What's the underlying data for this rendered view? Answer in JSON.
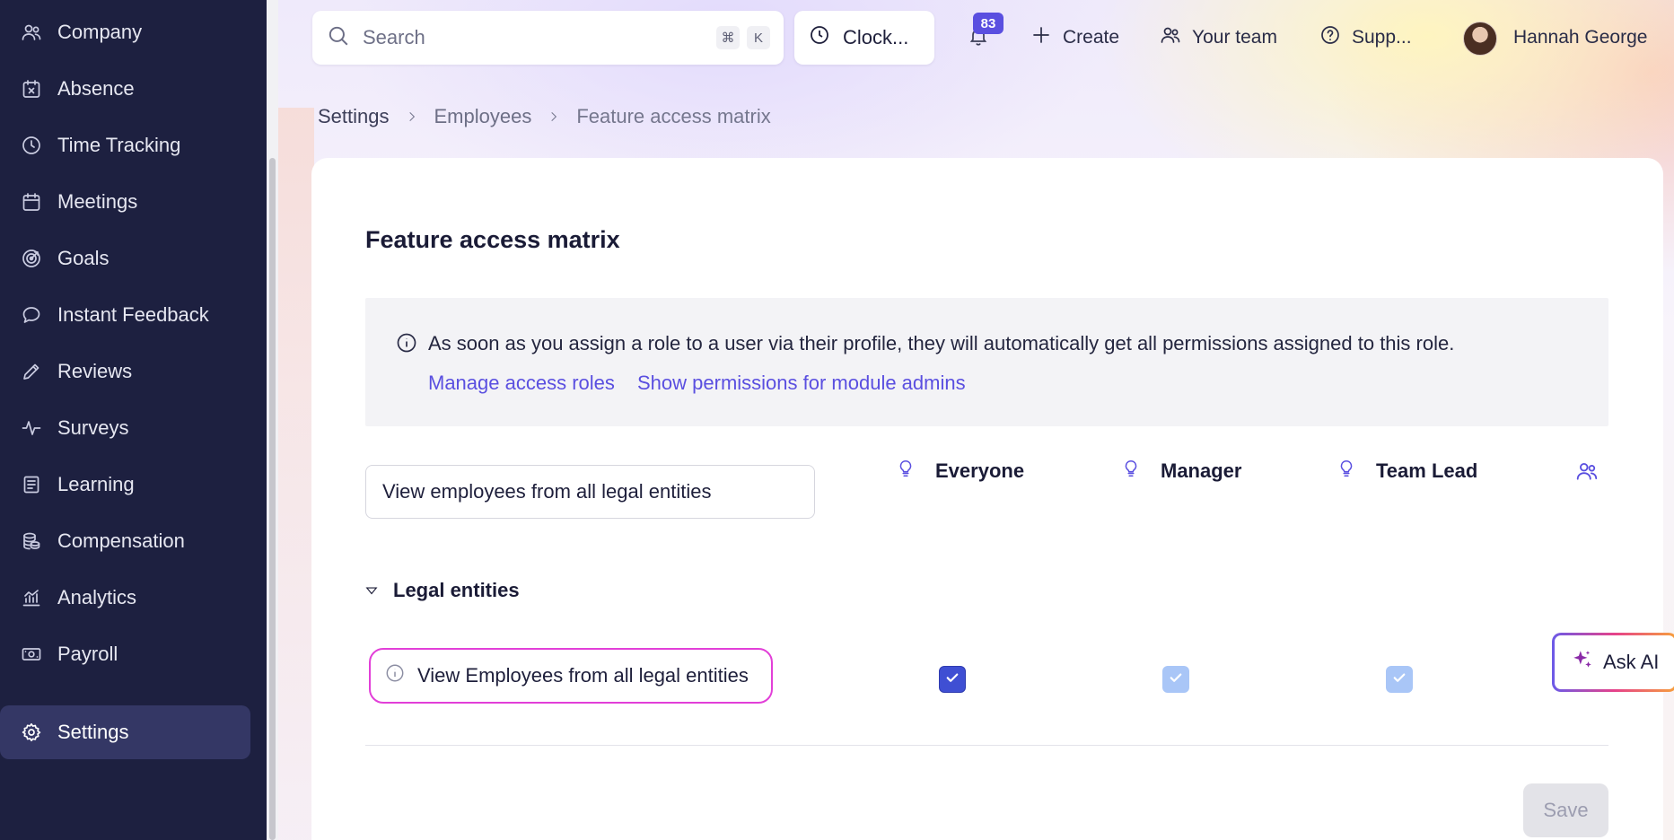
{
  "sidebar": {
    "items": [
      {
        "label": "Company",
        "icon": "users-icon",
        "active": false
      },
      {
        "label": "Absence",
        "icon": "calendar-x-icon",
        "active": false
      },
      {
        "label": "Time Tracking",
        "icon": "clock-icon",
        "active": false
      },
      {
        "label": "Meetings",
        "icon": "calendar-icon",
        "active": false
      },
      {
        "label": "Goals",
        "icon": "target-icon",
        "active": false
      },
      {
        "label": "Instant Feedback",
        "icon": "chat-bubble-icon",
        "active": false
      },
      {
        "label": "Reviews",
        "icon": "pencil-icon",
        "active": false
      },
      {
        "label": "Surveys",
        "icon": "pulse-icon",
        "active": false
      },
      {
        "label": "Learning",
        "icon": "book-icon",
        "active": false
      },
      {
        "label": "Compensation",
        "icon": "coins-icon",
        "active": false
      },
      {
        "label": "Analytics",
        "icon": "chart-icon",
        "active": false
      },
      {
        "label": "Payroll",
        "icon": "banknote-icon",
        "active": false
      },
      {
        "label": "Settings",
        "icon": "gear-icon",
        "active": true
      }
    ]
  },
  "topbar": {
    "search_placeholder": "Search",
    "shortcut_keys": [
      "⌘",
      "K"
    ],
    "clock_label": "Clock...",
    "notification_count": "83",
    "create_label": "Create",
    "team_label": "Your team",
    "support_label": "Supp...",
    "user_name": "Hannah George"
  },
  "breadcrumb": [
    "Settings",
    "Employees",
    "Feature access matrix"
  ],
  "page": {
    "title": "Feature access matrix",
    "info_text": "As soon as you assign a role to a user via their profile, they will automatically get all permissions assigned to this role.",
    "link_manage_roles": "Manage access roles",
    "link_module_admins": "Show permissions for module admins",
    "filter_value": "View employees from all legal entities",
    "roles": [
      "Everyone",
      "Manager",
      "Team Lead"
    ],
    "group_label": "Legal entities",
    "permission_label": "View Employees from all legal entities",
    "permission_states": [
      "checked",
      "inherited",
      "inherited"
    ],
    "save_label": "Save",
    "ask_ai_label": "Ask AI"
  },
  "colors": {
    "sidebar_bg": "#1d2040",
    "accent": "#5a4fe0",
    "checkbox_checked": "#3f4fd3",
    "checkbox_inherited": "#a9c6f7",
    "highlight_border": "#e23fd8"
  }
}
